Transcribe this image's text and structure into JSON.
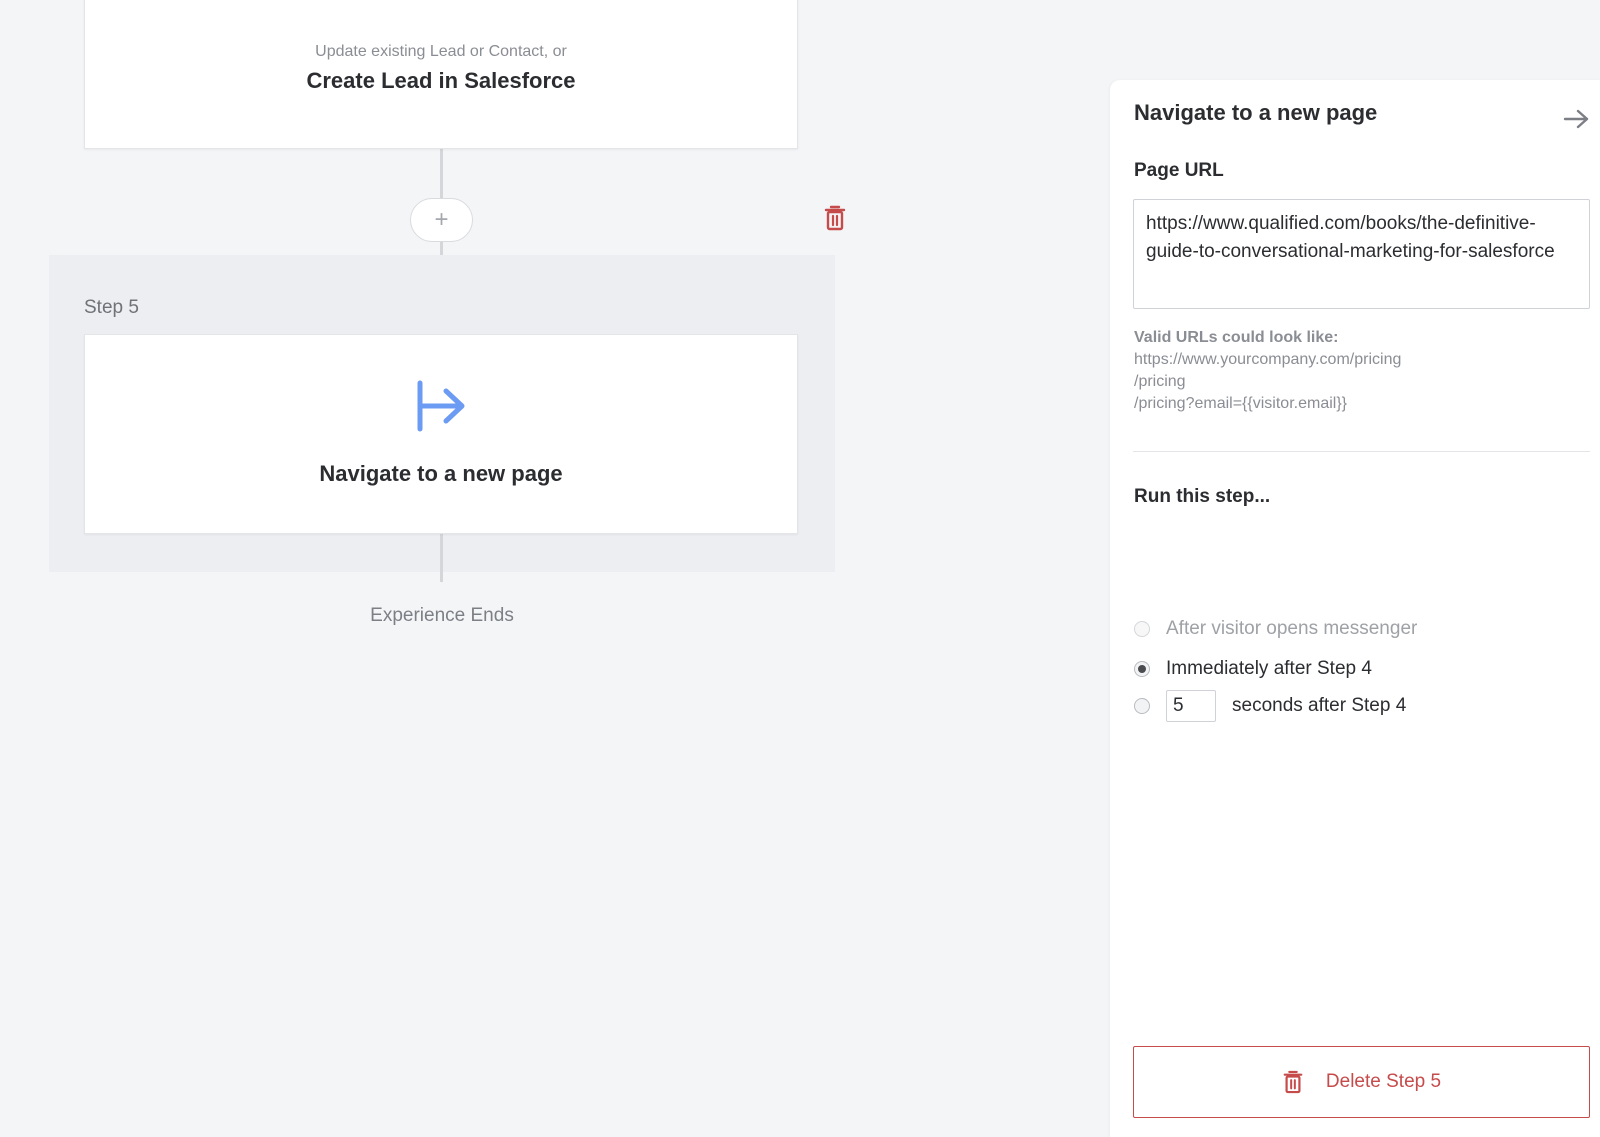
{
  "previous_step": {
    "subtitle": "Update existing Lead or Contact, or",
    "title": "Create Lead in Salesforce"
  },
  "flow": {
    "add_step_label": "+",
    "step_label": "Step 5",
    "step_title": "Navigate to a new page",
    "end_label": "Experience Ends",
    "step_icon": "navigate-arrow-icon",
    "delete_icon": "trash-icon"
  },
  "panel": {
    "title": "Navigate to a new page",
    "close_icon": "arrow-right-icon",
    "page_url_label": "Page URL",
    "page_url_value": "https://www.qualified.com/books/the-definitive-guide-to-conversational-marketing-for-salesforce",
    "hint_heading": "Valid URLs could look like:",
    "hint_examples": [
      "https://www.yourcompany.com/pricing",
      "/pricing",
      "/pricing?email={{visitor.email}}"
    ],
    "run_label": "Run this step...",
    "options": [
      {
        "label": "After visitor opens messenger",
        "selected": false,
        "disabled": true
      },
      {
        "label": "Immediately after Step 4",
        "selected": true,
        "disabled": false
      },
      {
        "label": "seconds after Step 4",
        "selected": false,
        "disabled": false
      }
    ],
    "seconds_value": "5",
    "delete_button": "Delete Step 5"
  },
  "colors": {
    "accent_blue": "#6b9bf2",
    "danger_red": "#c64b4b",
    "background": "#f4f5f7"
  }
}
